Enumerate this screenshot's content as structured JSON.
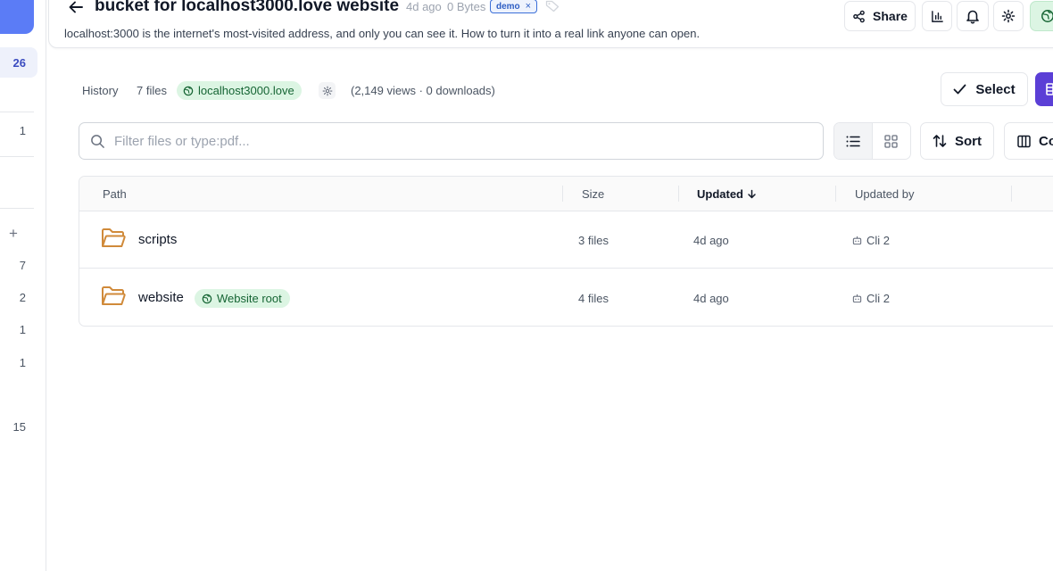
{
  "sidebar": {
    "counts": [
      "26",
      "1",
      "7",
      "2",
      "1",
      "1",
      "15"
    ]
  },
  "header": {
    "title": "bucket for localhost3000.love website",
    "age": "4d ago",
    "size": "0 Bytes",
    "tag": "demo",
    "tag_remove": "×",
    "description": "localhost:3000 is the internet's most-visited address, and only you can see it. How to turn it into a real link anyone can open.",
    "share_label": "Share"
  },
  "toolbar": {
    "history_label": "History",
    "files_count": "7 files",
    "domain": "localhost3000.love",
    "stats": "(2,149 views · 0 downloads)",
    "select_label": "Select"
  },
  "search": {
    "placeholder": "Filter files or type:pdf...",
    "value": ""
  },
  "controls": {
    "sort_label": "Sort",
    "columns_label": "Co"
  },
  "table": {
    "columns": [
      "Path",
      "Size",
      "Updated",
      "Updated by"
    ],
    "rows": [
      {
        "name": "scripts",
        "size": "3 files",
        "updated": "4d ago",
        "updated_by": "Cli 2"
      },
      {
        "name": "website",
        "badge": "Website root",
        "size": "4 files",
        "updated": "4d ago",
        "updated_by": "Cli 2"
      }
    ]
  },
  "colors": {
    "accent": "#5b3fd6",
    "sidebar_accent": "#5b7cf6",
    "folder": "#d08a3a",
    "green_pill_bg": "#dcf5e3",
    "green_text": "#166534",
    "demo_tag": "#2f5fc4"
  }
}
